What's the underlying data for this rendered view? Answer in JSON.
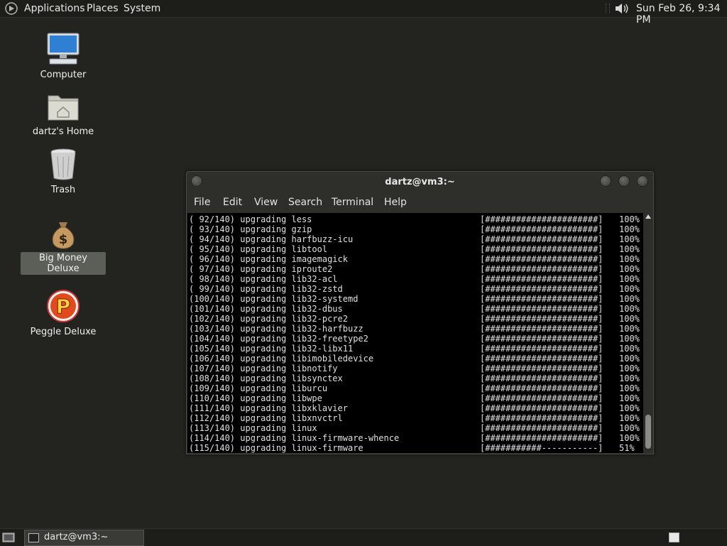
{
  "top_panel": {
    "menus": [
      "Applications",
      "Places",
      "System"
    ],
    "clock": "Sun Feb 26,  9:34 PM"
  },
  "desktop": {
    "icons": [
      {
        "label": "Computer",
        "icon": "computer-icon"
      },
      {
        "label": "dartz's Home",
        "icon": "home-folder-icon"
      },
      {
        "label": "Trash",
        "icon": "trash-icon"
      },
      {
        "label": "Big Money Deluxe",
        "icon": "money-bag-icon",
        "selected": true
      },
      {
        "label": "Peggle Deluxe",
        "icon": "peggle-icon"
      }
    ]
  },
  "terminal": {
    "title": "dartz@vm3:~",
    "menus": [
      "File",
      "Edit",
      "View",
      "Search",
      "Terminal",
      "Help"
    ],
    "lines": [
      {
        "counter": "( 92/140)",
        "action": "upgrading",
        "package": "less",
        "bar": "[######################]",
        "percent": "100%"
      },
      {
        "counter": "( 93/140)",
        "action": "upgrading",
        "package": "gzip",
        "bar": "[######################]",
        "percent": "100%"
      },
      {
        "counter": "( 94/140)",
        "action": "upgrading",
        "package": "harfbuzz-icu",
        "bar": "[######################]",
        "percent": "100%"
      },
      {
        "counter": "( 95/140)",
        "action": "upgrading",
        "package": "libtool",
        "bar": "[######################]",
        "percent": "100%"
      },
      {
        "counter": "( 96/140)",
        "action": "upgrading",
        "package": "imagemagick",
        "bar": "[######################]",
        "percent": "100%"
      },
      {
        "counter": "( 97/140)",
        "action": "upgrading",
        "package": "iproute2",
        "bar": "[######################]",
        "percent": "100%"
      },
      {
        "counter": "( 98/140)",
        "action": "upgrading",
        "package": "lib32-acl",
        "bar": "[######################]",
        "percent": "100%"
      },
      {
        "counter": "( 99/140)",
        "action": "upgrading",
        "package": "lib32-zstd",
        "bar": "[######################]",
        "percent": "100%"
      },
      {
        "counter": "(100/140)",
        "action": "upgrading",
        "package": "lib32-systemd",
        "bar": "[######################]",
        "percent": "100%"
      },
      {
        "counter": "(101/140)",
        "action": "upgrading",
        "package": "lib32-dbus",
        "bar": "[######################]",
        "percent": "100%"
      },
      {
        "counter": "(102/140)",
        "action": "upgrading",
        "package": "lib32-pcre2",
        "bar": "[######################]",
        "percent": "100%"
      },
      {
        "counter": "(103/140)",
        "action": "upgrading",
        "package": "lib32-harfbuzz",
        "bar": "[######################]",
        "percent": "100%"
      },
      {
        "counter": "(104/140)",
        "action": "upgrading",
        "package": "lib32-freetype2",
        "bar": "[######################]",
        "percent": "100%"
      },
      {
        "counter": "(105/140)",
        "action": "upgrading",
        "package": "lib32-libx11",
        "bar": "[######################]",
        "percent": "100%"
      },
      {
        "counter": "(106/140)",
        "action": "upgrading",
        "package": "libimobiledevice",
        "bar": "[######################]",
        "percent": "100%"
      },
      {
        "counter": "(107/140)",
        "action": "upgrading",
        "package": "libnotify",
        "bar": "[######################]",
        "percent": "100%"
      },
      {
        "counter": "(108/140)",
        "action": "upgrading",
        "package": "libsynctex",
        "bar": "[######################]",
        "percent": "100%"
      },
      {
        "counter": "(109/140)",
        "action": "upgrading",
        "package": "liburcu",
        "bar": "[######################]",
        "percent": "100%"
      },
      {
        "counter": "(110/140)",
        "action": "upgrading",
        "package": "libwpe",
        "bar": "[######################]",
        "percent": "100%"
      },
      {
        "counter": "(111/140)",
        "action": "upgrading",
        "package": "libxklavier",
        "bar": "[######################]",
        "percent": "100%"
      },
      {
        "counter": "(112/140)",
        "action": "upgrading",
        "package": "libxnvctrl",
        "bar": "[######################]",
        "percent": "100%"
      },
      {
        "counter": "(113/140)",
        "action": "upgrading",
        "package": "linux",
        "bar": "[######################]",
        "percent": "100%"
      },
      {
        "counter": "(114/140)",
        "action": "upgrading",
        "package": "linux-firmware-whence",
        "bar": "[######################]",
        "percent": "100%"
      },
      {
        "counter": "(115/140)",
        "action": "upgrading",
        "package": "linux-firmware",
        "bar": "[###########-----------]",
        "percent": "51%"
      }
    ]
  },
  "taskbar": {
    "tasks": [
      {
        "label": "dartz@vm3:~"
      }
    ]
  }
}
